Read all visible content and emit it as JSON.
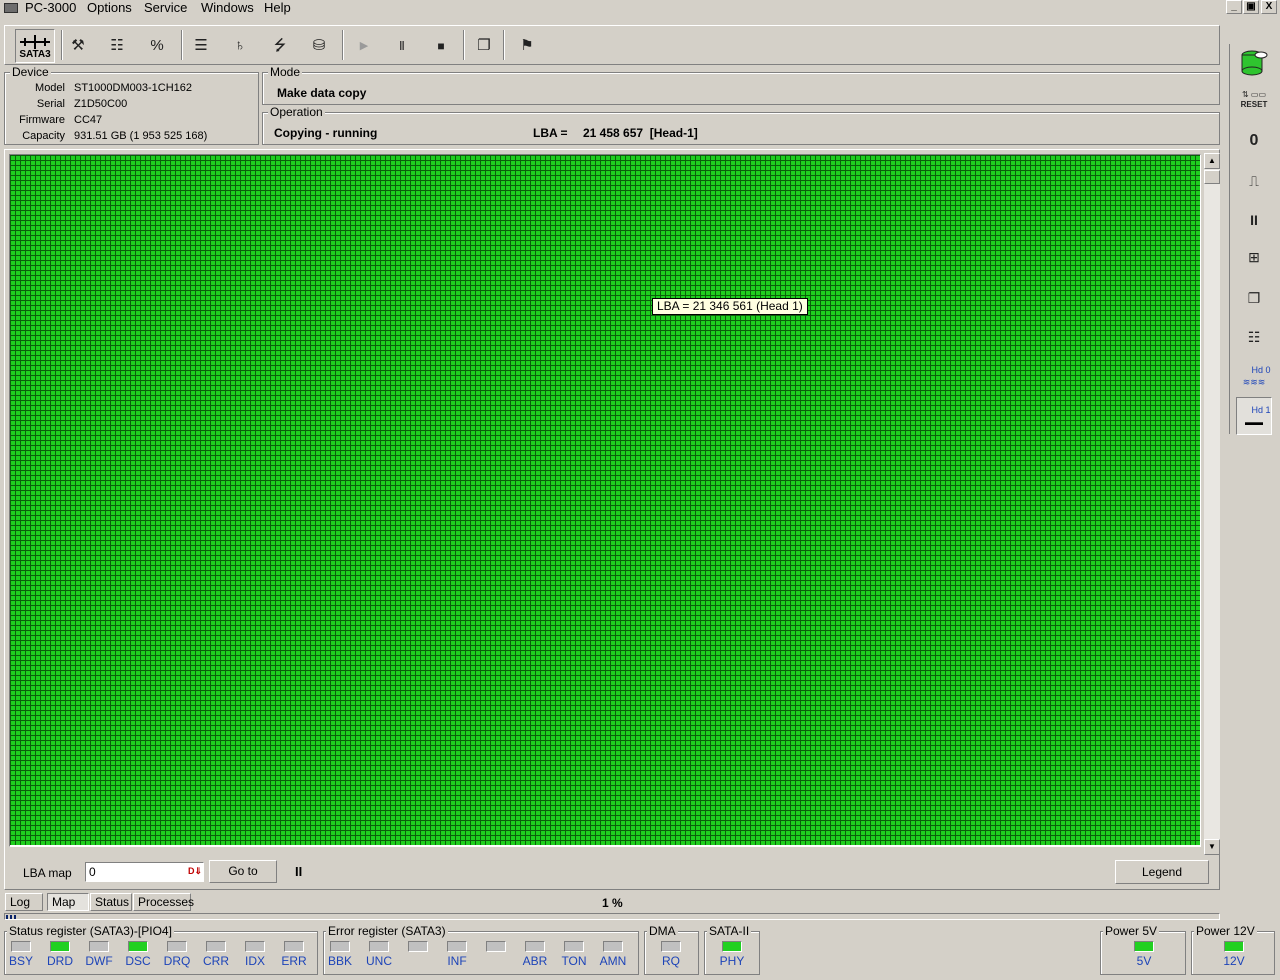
{
  "menubar": {
    "title": "PC-3000",
    "items": [
      "Options",
      "Service",
      "Windows",
      "Help"
    ],
    "window_controls": [
      "_",
      "▣",
      "X"
    ]
  },
  "toolbar": {
    "sata_label": "SATA3",
    "buttons": [
      {
        "name": "tools-icon",
        "glyph": "⚒"
      },
      {
        "name": "drive-info-icon",
        "glyph": "☷"
      },
      {
        "name": "percent-icon",
        "glyph": "%"
      },
      {
        "name": "tree-icon",
        "glyph": "☰"
      },
      {
        "name": "binoculars-icon",
        "glyph": "♄"
      },
      {
        "name": "heads-icon",
        "glyph": "⭍"
      },
      {
        "name": "disk-icon",
        "glyph": "⛁"
      },
      {
        "name": "play-icon",
        "glyph": "▶"
      },
      {
        "name": "pause-icon",
        "glyph": "Ⅱ"
      },
      {
        "name": "stop-icon",
        "glyph": "■"
      },
      {
        "name": "copy-windows-icon",
        "glyph": "❐"
      },
      {
        "name": "exit-icon",
        "glyph": "⚑"
      }
    ]
  },
  "device": {
    "title": "Device",
    "model_label": "Model",
    "model": "ST1000DM003-1CH162",
    "serial_label": "Serial",
    "serial": "Z1D50C00",
    "firmware_label": "Firmware",
    "firmware": "CC47",
    "capacity_label": "Capacity",
    "capacity": "931.51 GB (1 953 525 168)"
  },
  "mode": {
    "title": "Mode",
    "value": "Make data copy"
  },
  "operation": {
    "title": "Operation",
    "status": "Copying - running",
    "lba_label": "LBA =",
    "lba_value": "21 458 657  [Head-1]"
  },
  "map": {
    "tooltip": "LBA =  21 346 561 (Head 1)",
    "block_color": "#1fcf1f",
    "lba_map_label": "LBA map",
    "lba_input_value": "0",
    "goto_label": "Go to",
    "pause_label": "II",
    "legend_label": "Legend"
  },
  "tabs": [
    "Log",
    "Map",
    "Status",
    "Processes"
  ],
  "progress": {
    "percent_text": "1 %"
  },
  "status_register": {
    "title": "Status register (SATA3)-[PIO4]",
    "leds": [
      {
        "label": "BSY",
        "on": false
      },
      {
        "label": "DRD",
        "on": true
      },
      {
        "label": "DWF",
        "on": false
      },
      {
        "label": "DSC",
        "on": true
      },
      {
        "label": "DRQ",
        "on": false
      },
      {
        "label": "CRR",
        "on": false
      },
      {
        "label": "IDX",
        "on": false
      },
      {
        "label": "ERR",
        "on": false
      }
    ]
  },
  "error_register": {
    "title": "Error register (SATA3)",
    "leds": [
      {
        "label": "BBK",
        "on": false
      },
      {
        "label": "UNC",
        "on": false
      },
      {
        "label": "",
        "on": false
      },
      {
        "label": "INF",
        "on": false
      },
      {
        "label": "",
        "on": false
      },
      {
        "label": "ABR",
        "on": false
      },
      {
        "label": "TON",
        "on": false
      },
      {
        "label": "AMN",
        "on": false
      }
    ]
  },
  "dma": {
    "title": "DMA",
    "label": "RQ",
    "on": false
  },
  "sata2": {
    "title": "SATA-II",
    "label": "PHY",
    "on": true
  },
  "power5": {
    "title": "Power 5V",
    "label": "5V",
    "on": true
  },
  "power12": {
    "title": "Power 12V",
    "label": "12V",
    "on": true
  },
  "sidebar": {
    "reset_label": "RESET",
    "hd0_label": "Hd 0",
    "hd1_label": "Hd 1"
  }
}
